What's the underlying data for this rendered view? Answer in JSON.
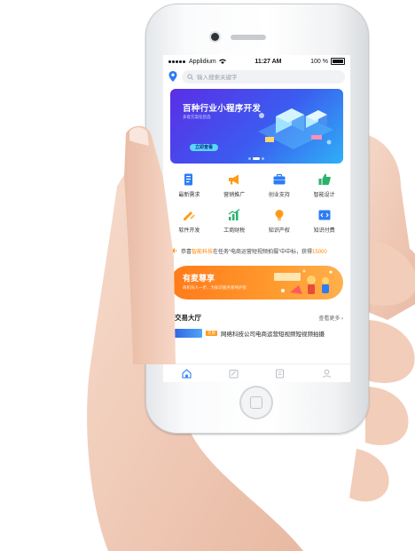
{
  "status_bar": {
    "carrier": "Applidium",
    "time": "11:27 AM",
    "battery": "100 %"
  },
  "search": {
    "placeholder": "输入搜索关键字"
  },
  "banner": {
    "title": "百种行业小程序开发",
    "subtitle": "多套方案任您选",
    "button": "立即查看"
  },
  "categories": [
    {
      "label": "最新需求",
      "icon": "document-icon",
      "color": "#2b7cf6"
    },
    {
      "label": "营销推广",
      "icon": "megaphone-icon",
      "color": "#ff9a1a"
    },
    {
      "label": "创业支持",
      "icon": "briefcase-icon",
      "color": "#2b7cf6"
    },
    {
      "label": "智能设计",
      "icon": "thumbs-up-icon",
      "color": "#27b36a"
    },
    {
      "label": "软件开发",
      "icon": "pencil-ruler-icon",
      "color": "#ff9a1a"
    },
    {
      "label": "工商财税",
      "icon": "chart-icon",
      "color": "#27b36a"
    },
    {
      "label": "知识产权",
      "icon": "lightbulb-icon",
      "color": "#ff9a1a"
    },
    {
      "label": "知识付费",
      "icon": "code-icon",
      "color": "#2b7cf6"
    }
  ],
  "notice": {
    "prefix": "恭喜",
    "company": "智能科技",
    "middle": "在任务“电商运营短视频拍摄”中中标，获得",
    "amount": "15000"
  },
  "promo": {
    "title": "有麦尊享",
    "subtitle": "商机快人一步，为知识服务保驾护航"
  },
  "trade_hall": {
    "title": "交易大厅",
    "more": "查看更多",
    "item": {
      "tag": "交易",
      "text": "网络科技公司电商运营短视频短视频拍摄"
    }
  },
  "tabbar": [
    {
      "name": "tab-home",
      "icon": "home-icon",
      "active": true
    },
    {
      "name": "tab-tasks",
      "icon": "edit-icon",
      "active": false
    },
    {
      "name": "tab-orders",
      "icon": "list-icon",
      "active": false
    },
    {
      "name": "tab-profile",
      "icon": "user-icon",
      "active": false
    }
  ],
  "colors": {
    "accent": "#2b7cf6",
    "orange": "#ff8a00",
    "banner_start": "#5b2ee6",
    "banner_end": "#2fb0f5"
  }
}
